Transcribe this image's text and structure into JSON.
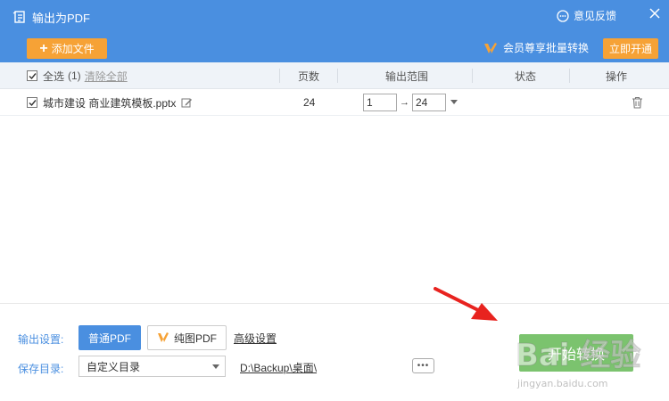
{
  "header": {
    "title": "输出为PDF",
    "feedback_label": "意见反馈",
    "add_file_label": "添加文件",
    "vip_promo_label": "会员尊享批量转换",
    "open_now_label": "立即开通"
  },
  "table": {
    "select_all_label": "全选",
    "select_all_count": "(1)",
    "clear_all_label": "清除全部",
    "columns": {
      "pages": "页数",
      "range": "输出范围",
      "status": "状态",
      "actions": "操作"
    },
    "rows": [
      {
        "filename": "城市建设 商业建筑模板.pptx",
        "pages": "24",
        "range_from": "1",
        "range_to": "24",
        "status": "",
        "checked": true
      }
    ]
  },
  "settings": {
    "output_label": "输出设置:",
    "normal_pdf_label": "普通PDF",
    "image_pdf_label": "纯图PDF",
    "advanced_label": "高级设置",
    "save_dir_label": "保存目录:",
    "dir_option": "自定义目录",
    "dir_path": "D:\\Backup\\桌面\\",
    "more_label": "•••",
    "start_label": "开始转换"
  },
  "watermark": {
    "text": "Bai 经验",
    "url": "jingyan.baidu.com"
  },
  "colors": {
    "header_bg": "#4a8fe0",
    "accent_orange": "#f6a236",
    "start_green": "#7bc36e",
    "arrow_red": "#e8231f"
  },
  "icons": {
    "title": "pdf-export-icon",
    "feedback": "chat-bubble-icon",
    "close": "close-icon",
    "vip": "vip-badge-icon",
    "edit": "edit-icon",
    "delete": "trash-icon"
  }
}
